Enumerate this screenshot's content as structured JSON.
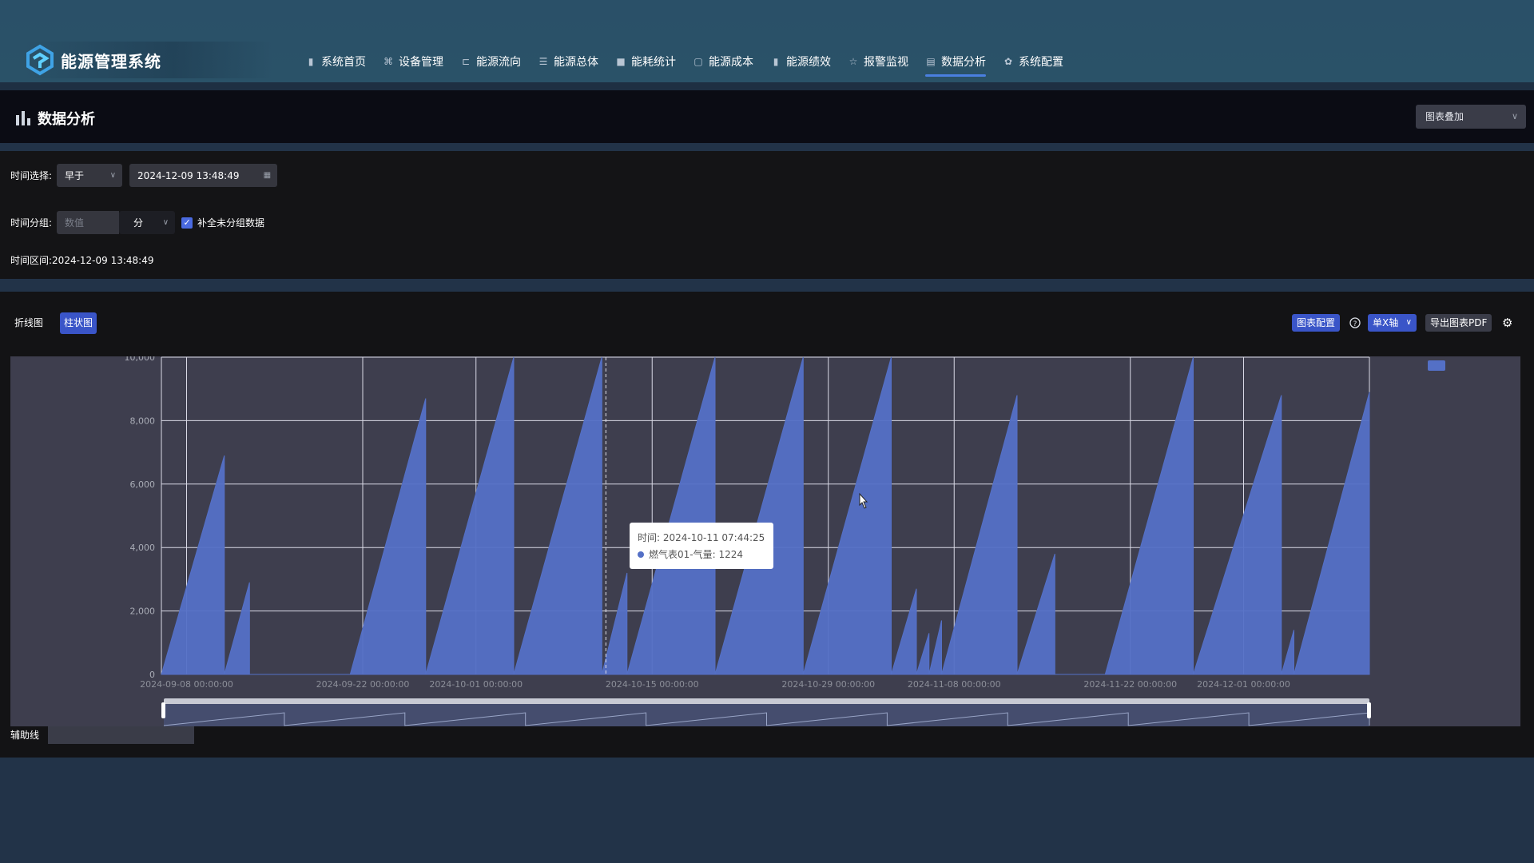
{
  "app": {
    "title": "能源管理系统"
  },
  "nav": [
    {
      "label": "系统首页",
      "icon": "bar-chart-icon"
    },
    {
      "label": "设备管理",
      "icon": "device-icon"
    },
    {
      "label": "能源流向",
      "icon": "flow-icon"
    },
    {
      "label": "能源总体",
      "icon": "database-icon"
    },
    {
      "label": "能耗统计",
      "icon": "stats-icon"
    },
    {
      "label": "能源成本",
      "icon": "document-icon"
    },
    {
      "label": "能源绩效",
      "icon": "bar-chart-icon"
    },
    {
      "label": "报警监视",
      "icon": "alarm-icon"
    },
    {
      "label": "数据分析",
      "icon": "analysis-icon",
      "active": true
    },
    {
      "label": "系统配置",
      "icon": "gear-icon"
    }
  ],
  "page": {
    "title": "数据分析",
    "overlay_select": "图表叠加"
  },
  "filters": {
    "time_label": "时间选择:",
    "time_mode": "早于",
    "time_value": "2024-12-09 13:48:49",
    "group_label": "时间分组:",
    "group_placeholder": "数值",
    "group_unit": "分",
    "fill_label": "补全未分组数据",
    "range_label": "时间区间:",
    "range_value": "2024-12-09 13:48:49"
  },
  "chart_panel": {
    "tabs": [
      "折线图",
      "柱状图"
    ],
    "active_tab": "柱状图",
    "config_button": "图表配置",
    "axis_select": "单X轴",
    "export_button": "导出图表PDF",
    "aux_label": "辅助线",
    "legend_color": "#5470c6"
  },
  "tooltip": {
    "time": "时间: 2024-10-11 07:44:25",
    "series_value": "燃气表01-气量: 1224"
  },
  "chart_data": {
    "type": "area",
    "title": "",
    "xlabel": "",
    "ylabel": "",
    "ylim": [
      0,
      10000
    ],
    "y_ticks": [
      "0",
      "2,000",
      "4,000",
      "6,000",
      "8,000",
      "10,000"
    ],
    "x_tick_labels": [
      "2024-09-08 00:00:00",
      "2024-09-22 00:00:00",
      "2024-10-01 00:00:00",
      "2024-10-15 00:00:00",
      "2024-10-29 00:00:00",
      "2024-11-08 00:00:00",
      "2024-11-22 00:00:00",
      "2024-12-01 00:00:00"
    ],
    "x_range": [
      "2024-09-06",
      "2024-12-11"
    ],
    "grid": true,
    "legend_placement": "top-right",
    "series": [
      {
        "color": "#5470c6",
        "points": [
          [
            "2024-09-06",
            0
          ],
          [
            "2024-09-11",
            6900
          ],
          [
            "2024-09-11",
            0
          ],
          [
            "2024-09-13",
            2900
          ],
          [
            "2024-09-13",
            0
          ],
          [
            "2024-09-21",
            0
          ],
          [
            "2024-09-27",
            8700
          ],
          [
            "2024-09-27",
            0
          ],
          [
            "2024-10-04",
            10000
          ],
          [
            "2024-10-04",
            0
          ],
          [
            "2024-10-11",
            10000
          ],
          [
            "2024-10-11",
            0
          ],
          [
            "2024-10-13",
            3200
          ],
          [
            "2024-10-13",
            0
          ],
          [
            "2024-10-20",
            10000
          ],
          [
            "2024-10-20",
            0
          ],
          [
            "2024-10-27",
            10000
          ],
          [
            "2024-10-27",
            0
          ],
          [
            "2024-11-03",
            10000
          ],
          [
            "2024-11-03",
            0
          ],
          [
            "2024-11-05",
            2700
          ],
          [
            "2024-11-05",
            0
          ],
          [
            "2024-11-06",
            1300
          ],
          [
            "2024-11-06",
            0
          ],
          [
            "2024-11-07",
            1700
          ],
          [
            "2024-11-07",
            0
          ],
          [
            "2024-11-13",
            8800
          ],
          [
            "2024-11-13",
            0
          ],
          [
            "2024-11-16",
            3800
          ],
          [
            "2024-11-16",
            0
          ],
          [
            "2024-11-16",
            600
          ],
          [
            "2024-11-16",
            0
          ],
          [
            "2024-11-20",
            0
          ],
          [
            "2024-11-27",
            10000
          ],
          [
            "2024-11-27",
            0
          ],
          [
            "2024-12-04",
            8800
          ],
          [
            "2024-12-04",
            0
          ],
          [
            "2024-12-05",
            1400
          ],
          [
            "2024-12-05",
            0
          ],
          [
            "2024-12-11",
            8900
          ],
          [
            "2024-12-11",
            0
          ]
        ]
      }
    ]
  }
}
